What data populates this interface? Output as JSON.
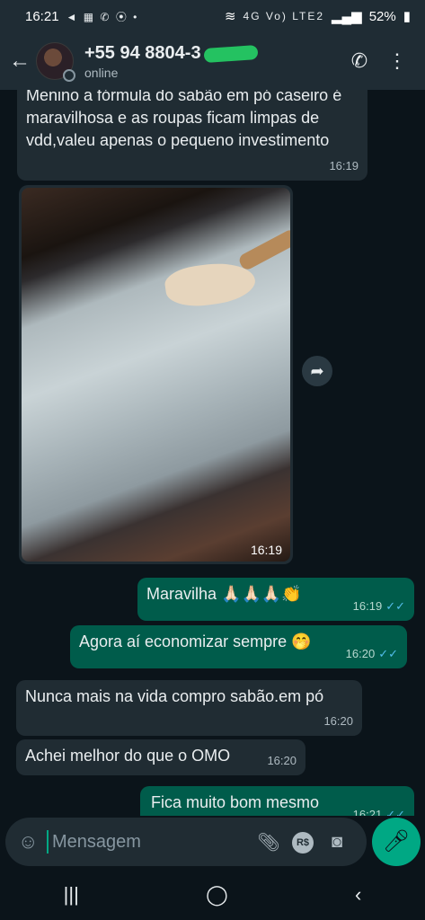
{
  "status_bar": {
    "time": "16:21",
    "left_icons": "◄ ▦ ✆ ⦿ •",
    "network": "4G Vo) LTE2",
    "battery": "52%"
  },
  "header": {
    "contact_name": "+55 94 8804-3",
    "status": "online"
  },
  "messages": [
    {
      "direction": "in",
      "text": "Menino a fórmula do sabão em pó caseiro é maravilhosa e as roupas ficam limpas de vdd,valeu apenas o pequeno investimento",
      "time": "16:19"
    },
    {
      "direction": "in",
      "type": "image",
      "time": "16:19"
    },
    {
      "direction": "out",
      "text": "Maravilha 🙏🏻🙏🏻🙏🏻👏",
      "time": "16:19",
      "ticks": "✓✓"
    },
    {
      "direction": "out",
      "text": "Agora aí economizar sempre 🤭",
      "time": "16:20",
      "ticks": "✓✓"
    },
    {
      "direction": "in",
      "text": "Nunca mais na vida compro sabão.em pó",
      "time": "16:20"
    },
    {
      "direction": "in",
      "text": "Achei melhor do que o OMO",
      "time": "16:20"
    },
    {
      "direction": "out",
      "text": "Fica muito bom mesmo",
      "time": "16:21",
      "ticks": "✓✓"
    }
  ],
  "input": {
    "placeholder": "Mensagem",
    "rs_label": "R$"
  },
  "colors": {
    "incoming": "#202c33",
    "outgoing": "#005c4b",
    "accent": "#00a884"
  },
  "icons": {
    "back": "arrow-left-icon",
    "call": "add-call-icon",
    "menu": "more-vert-icon",
    "forward": "forward-icon",
    "emoji": "emoji-icon",
    "attach": "paperclip-icon",
    "camera": "camera-icon",
    "mic": "mic-icon"
  }
}
